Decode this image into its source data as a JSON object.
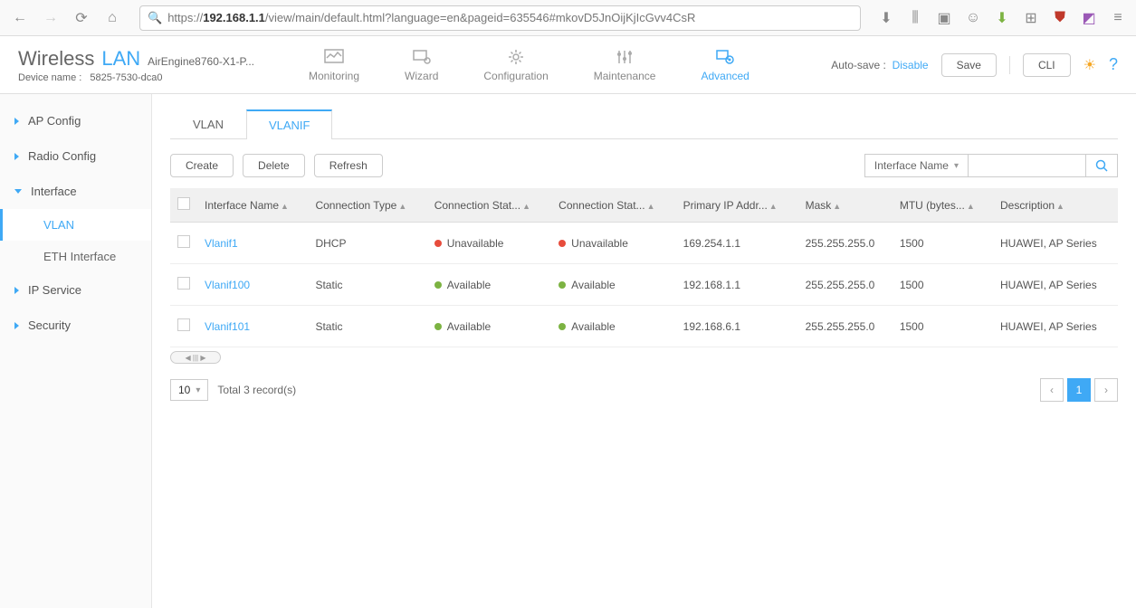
{
  "browser": {
    "url_prefix": "https://",
    "url_host": "192.168.1.1",
    "url_path": "/view/main/default.html?language=en&pageid=635546#mkovD5JnOijKjIcGvv4CsR"
  },
  "header": {
    "wireless": "Wireless",
    "lan": "LAN",
    "model": "AirEngine8760-X1-P...",
    "device_label": "Device name :",
    "device_name": "5825-7530-dca0",
    "nav": {
      "monitoring": "Monitoring",
      "wizard": "Wizard",
      "configuration": "Configuration",
      "maintenance": "Maintenance",
      "advanced": "Advanced"
    },
    "autosave_label": "Auto-save :",
    "autosave_action": "Disable",
    "save": "Save",
    "cli": "CLI"
  },
  "sidebar": {
    "ap": "AP Config",
    "radio": "Radio Config",
    "interface": "Interface",
    "vlan": "VLAN",
    "eth": "ETH Interface",
    "ip": "IP Service",
    "security": "Security"
  },
  "tabs": {
    "vlan": "VLAN",
    "vlanif": "VLANIF"
  },
  "actions": {
    "create": "Create",
    "delete": "Delete",
    "refresh": "Refresh"
  },
  "filter": {
    "field": "Interface Name"
  },
  "columns": {
    "name": "Interface Name",
    "conn_type": "Connection Type",
    "conn_stat1": "Connection Stat...",
    "conn_stat2": "Connection Stat...",
    "primary_ip": "Primary IP Addr...",
    "mask": "Mask",
    "mtu": "MTU (bytes...",
    "desc": "Description"
  },
  "rows": [
    {
      "name": "Vlanif1",
      "type": "DHCP",
      "s1": "Unavailable",
      "s1c": "red",
      "s2": "Unavailable",
      "s2c": "red",
      "ip": "169.254.1.1",
      "mask": "255.255.255.0",
      "mtu": "1500",
      "desc": "HUAWEI, AP Series"
    },
    {
      "name": "Vlanif100",
      "type": "Static",
      "s1": "Available",
      "s1c": "green",
      "s2": "Available",
      "s2c": "green",
      "ip": "192.168.1.1",
      "mask": "255.255.255.0",
      "mtu": "1500",
      "desc": "HUAWEI, AP Series"
    },
    {
      "name": "Vlanif101",
      "type": "Static",
      "s1": "Available",
      "s1c": "green",
      "s2": "Available",
      "s2c": "green",
      "ip": "192.168.6.1",
      "mask": "255.255.255.0",
      "mtu": "1500",
      "desc": "HUAWEI, AP Series"
    }
  ],
  "pager": {
    "size": "10",
    "total": "Total 3 record(s)",
    "page": "1"
  }
}
